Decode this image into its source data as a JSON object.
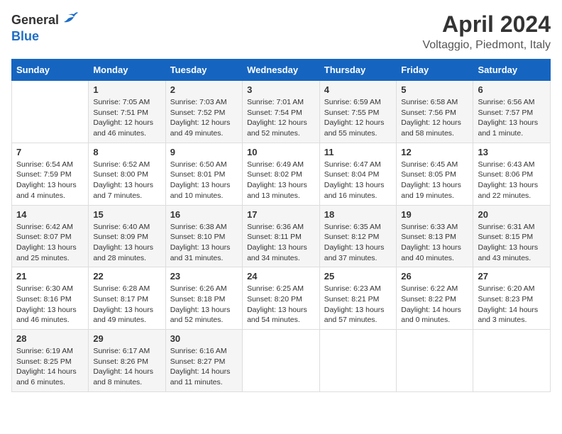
{
  "header": {
    "logo_general": "General",
    "logo_blue": "Blue",
    "title": "April 2024",
    "location": "Voltaggio, Piedmont, Italy"
  },
  "columns": [
    "Sunday",
    "Monday",
    "Tuesday",
    "Wednesday",
    "Thursday",
    "Friday",
    "Saturday"
  ],
  "weeks": [
    [
      {
        "day": "",
        "sunrise": "",
        "sunset": "",
        "daylight": ""
      },
      {
        "day": "1",
        "sunrise": "Sunrise: 7:05 AM",
        "sunset": "Sunset: 7:51 PM",
        "daylight": "Daylight: 12 hours and 46 minutes."
      },
      {
        "day": "2",
        "sunrise": "Sunrise: 7:03 AM",
        "sunset": "Sunset: 7:52 PM",
        "daylight": "Daylight: 12 hours and 49 minutes."
      },
      {
        "day": "3",
        "sunrise": "Sunrise: 7:01 AM",
        "sunset": "Sunset: 7:54 PM",
        "daylight": "Daylight: 12 hours and 52 minutes."
      },
      {
        "day": "4",
        "sunrise": "Sunrise: 6:59 AM",
        "sunset": "Sunset: 7:55 PM",
        "daylight": "Daylight: 12 hours and 55 minutes."
      },
      {
        "day": "5",
        "sunrise": "Sunrise: 6:58 AM",
        "sunset": "Sunset: 7:56 PM",
        "daylight": "Daylight: 12 hours and 58 minutes."
      },
      {
        "day": "6",
        "sunrise": "Sunrise: 6:56 AM",
        "sunset": "Sunset: 7:57 PM",
        "daylight": "Daylight: 13 hours and 1 minute."
      }
    ],
    [
      {
        "day": "7",
        "sunrise": "Sunrise: 6:54 AM",
        "sunset": "Sunset: 7:59 PM",
        "daylight": "Daylight: 13 hours and 4 minutes."
      },
      {
        "day": "8",
        "sunrise": "Sunrise: 6:52 AM",
        "sunset": "Sunset: 8:00 PM",
        "daylight": "Daylight: 13 hours and 7 minutes."
      },
      {
        "day": "9",
        "sunrise": "Sunrise: 6:50 AM",
        "sunset": "Sunset: 8:01 PM",
        "daylight": "Daylight: 13 hours and 10 minutes."
      },
      {
        "day": "10",
        "sunrise": "Sunrise: 6:49 AM",
        "sunset": "Sunset: 8:02 PM",
        "daylight": "Daylight: 13 hours and 13 minutes."
      },
      {
        "day": "11",
        "sunrise": "Sunrise: 6:47 AM",
        "sunset": "Sunset: 8:04 PM",
        "daylight": "Daylight: 13 hours and 16 minutes."
      },
      {
        "day": "12",
        "sunrise": "Sunrise: 6:45 AM",
        "sunset": "Sunset: 8:05 PM",
        "daylight": "Daylight: 13 hours and 19 minutes."
      },
      {
        "day": "13",
        "sunrise": "Sunrise: 6:43 AM",
        "sunset": "Sunset: 8:06 PM",
        "daylight": "Daylight: 13 hours and 22 minutes."
      }
    ],
    [
      {
        "day": "14",
        "sunrise": "Sunrise: 6:42 AM",
        "sunset": "Sunset: 8:07 PM",
        "daylight": "Daylight: 13 hours and 25 minutes."
      },
      {
        "day": "15",
        "sunrise": "Sunrise: 6:40 AM",
        "sunset": "Sunset: 8:09 PM",
        "daylight": "Daylight: 13 hours and 28 minutes."
      },
      {
        "day": "16",
        "sunrise": "Sunrise: 6:38 AM",
        "sunset": "Sunset: 8:10 PM",
        "daylight": "Daylight: 13 hours and 31 minutes."
      },
      {
        "day": "17",
        "sunrise": "Sunrise: 6:36 AM",
        "sunset": "Sunset: 8:11 PM",
        "daylight": "Daylight: 13 hours and 34 minutes."
      },
      {
        "day": "18",
        "sunrise": "Sunrise: 6:35 AM",
        "sunset": "Sunset: 8:12 PM",
        "daylight": "Daylight: 13 hours and 37 minutes."
      },
      {
        "day": "19",
        "sunrise": "Sunrise: 6:33 AM",
        "sunset": "Sunset: 8:13 PM",
        "daylight": "Daylight: 13 hours and 40 minutes."
      },
      {
        "day": "20",
        "sunrise": "Sunrise: 6:31 AM",
        "sunset": "Sunset: 8:15 PM",
        "daylight": "Daylight: 13 hours and 43 minutes."
      }
    ],
    [
      {
        "day": "21",
        "sunrise": "Sunrise: 6:30 AM",
        "sunset": "Sunset: 8:16 PM",
        "daylight": "Daylight: 13 hours and 46 minutes."
      },
      {
        "day": "22",
        "sunrise": "Sunrise: 6:28 AM",
        "sunset": "Sunset: 8:17 PM",
        "daylight": "Daylight: 13 hours and 49 minutes."
      },
      {
        "day": "23",
        "sunrise": "Sunrise: 6:26 AM",
        "sunset": "Sunset: 8:18 PM",
        "daylight": "Daylight: 13 hours and 52 minutes."
      },
      {
        "day": "24",
        "sunrise": "Sunrise: 6:25 AM",
        "sunset": "Sunset: 8:20 PM",
        "daylight": "Daylight: 13 hours and 54 minutes."
      },
      {
        "day": "25",
        "sunrise": "Sunrise: 6:23 AM",
        "sunset": "Sunset: 8:21 PM",
        "daylight": "Daylight: 13 hours and 57 minutes."
      },
      {
        "day": "26",
        "sunrise": "Sunrise: 6:22 AM",
        "sunset": "Sunset: 8:22 PM",
        "daylight": "Daylight: 14 hours and 0 minutes."
      },
      {
        "day": "27",
        "sunrise": "Sunrise: 6:20 AM",
        "sunset": "Sunset: 8:23 PM",
        "daylight": "Daylight: 14 hours and 3 minutes."
      }
    ],
    [
      {
        "day": "28",
        "sunrise": "Sunrise: 6:19 AM",
        "sunset": "Sunset: 8:25 PM",
        "daylight": "Daylight: 14 hours and 6 minutes."
      },
      {
        "day": "29",
        "sunrise": "Sunrise: 6:17 AM",
        "sunset": "Sunset: 8:26 PM",
        "daylight": "Daylight: 14 hours and 8 minutes."
      },
      {
        "day": "30",
        "sunrise": "Sunrise: 6:16 AM",
        "sunset": "Sunset: 8:27 PM",
        "daylight": "Daylight: 14 hours and 11 minutes."
      },
      {
        "day": "",
        "sunrise": "",
        "sunset": "",
        "daylight": ""
      },
      {
        "day": "",
        "sunrise": "",
        "sunset": "",
        "daylight": ""
      },
      {
        "day": "",
        "sunrise": "",
        "sunset": "",
        "daylight": ""
      },
      {
        "day": "",
        "sunrise": "",
        "sunset": "",
        "daylight": ""
      }
    ]
  ]
}
